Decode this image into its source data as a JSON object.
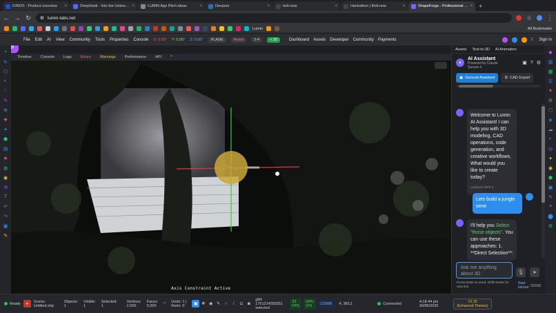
{
  "browser": {
    "tabs": [
      {
        "title": "IONOS - Product overview",
        "color": "#1d4ed8"
      },
      {
        "title": "DeepSeek - Into the Unknown",
        "color": "#4f6bff"
      },
      {
        "title": "LUMIN App Pitch Ideas",
        "color": "#888888"
      },
      {
        "title": "Devpost",
        "color": "#2a6fb5"
      },
      {
        "title": "bolt.new",
        "color": "#444444"
      },
      {
        "title": "Hackathon | Bolt.new",
        "color": "#444444"
      },
      {
        "title": "ShapeForge - Professional 3D T...",
        "color": "#7b61ff"
      }
    ],
    "new_tab": "+",
    "url": "lumin-labs.net",
    "all_bookmarks": "All Bookmarks",
    "bookmark_lumin": "Lumin",
    "bookmark_colors": [
      "#ff8a00",
      "#1dbf73",
      "#4f6bff",
      "#2aa8ff",
      "#e05a5a",
      "#cccccc",
      "#1da1f2",
      "#6b7280",
      "#e74c3c",
      "#8e44ad",
      "#2ecc71",
      "#3498db",
      "#f39c12",
      "#1abc9c",
      "#e84393",
      "#95a5a6",
      "#27ae60",
      "#2980b9",
      "#c0392b",
      "#d35400",
      "#16a085",
      "#7f8c8d",
      "#ff5252",
      "#9b59b6",
      "#34495e",
      "#e67e22",
      "#f1c40f",
      "#2ecc71",
      "#e91e63",
      "#00bcd4",
      "#ff9800",
      "#795548"
    ]
  },
  "app": {
    "menu": [
      "File",
      "Edit",
      "AI",
      "View",
      "Community"
    ],
    "tools": [
      "Tools",
      "Properties",
      "Console"
    ],
    "coords": {
      "x": "X: 0.00°",
      "y": "Y: 0.00°",
      "z": "Z: 0.00°"
    },
    "plane": "PLANE",
    "reset": "Reset",
    "snap": "3-4",
    "add30": "+ 30",
    "right_menu": [
      "Dashboard",
      "Assets",
      "Developer",
      "Community",
      "Payments"
    ],
    "sign_in": "Sign In"
  },
  "panel_tabs": {
    "timeline": "Timeline",
    "console": "Console",
    "logs": "Logs",
    "errors": "Errors",
    "warnings": "Warnings",
    "performance": "Performance",
    "api": "API"
  },
  "viewport": {
    "axis_constraint": "Axis Constraint Active"
  },
  "right_panel": {
    "top": {
      "assets": "Assets",
      "text3d": "Text-to-3D",
      "anim": "AI Animation"
    },
    "title": "AI Assistant",
    "powered": "Powered by Claude",
    "model": "Sonnet 4",
    "tab_general": "General Assistant",
    "tab_cad": "CAD Expert",
    "welcome": "Welcome to Lumin AI Assistant! I can help you with 3D modeling, CAD operations, code generation, and creative workflows. What would you like to create today?",
    "welcome_meta": "LuminAI-GPT-4",
    "user_msg": "Lets build a jungle sene",
    "reply_pre": "I'll help you ",
    "reply_hl": "Select \"those objects\"",
    "reply_post": ". You can use these approaches: 1. **Direct Selection**:",
    "input_placeholder": "Ask me anything about 3D",
    "hint": "Press Enter to send, Shift+Enter for new line",
    "tutorial": "Start tutorial",
    "count": "0/2000"
  },
  "status": {
    "ready": "Ready",
    "scene_label": "Scene:",
    "scene": "Untitled.shp",
    "objects_label": "Objects:",
    "objects": "1",
    "visible_label": "Visible:",
    "visible": "1",
    "selected_label": "Selected:",
    "selected": "1",
    "vertices_label": "Vertices:",
    "vertices": "2,500",
    "faces_label": "Faces:",
    "faces": "5,000",
    "undo": "Undo: 1 | Redo: 0",
    "obj_id": "glbf-1751314559251",
    "obj_state": "selected",
    "fps": "33",
    "fps_label": "FPS",
    "gpu": "GPU",
    "gpu_val": "376",
    "mem": "123MB",
    "pos": "4, 382,1",
    "connected": "Connected",
    "time": "4:18:44 pm",
    "date": "30/06/2025",
    "version": "V1.29",
    "version_sub": "(Enhanced Themes)"
  }
}
